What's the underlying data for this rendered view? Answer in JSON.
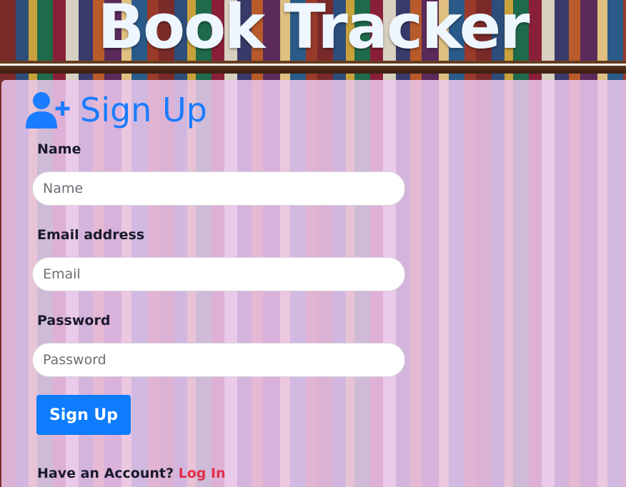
{
  "app": {
    "title": "Book Tracker"
  },
  "form": {
    "heading": "Sign Up",
    "name_label": "Name",
    "name_placeholder": "Name",
    "email_label": "Email address",
    "email_placeholder": "Email",
    "password_label": "Password",
    "password_placeholder": "Password",
    "submit_label": "Sign Up",
    "footer_text": "Have an Account?",
    "login_link": "Log In"
  },
  "colors": {
    "accent": "#0d7cff",
    "link": "#e0304a",
    "panel": "#ecc8f0"
  },
  "icons": {
    "heading_icon": "user-plus-icon"
  }
}
